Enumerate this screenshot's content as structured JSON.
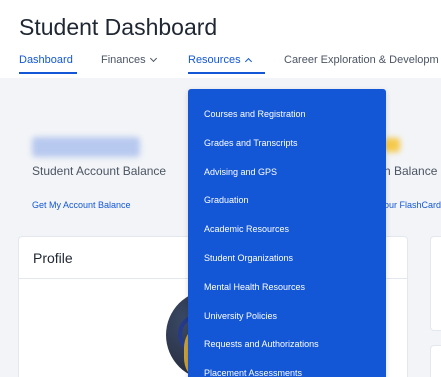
{
  "page": {
    "title": "Student Dashboard"
  },
  "nav": {
    "items": [
      {
        "label": "Dashboard"
      },
      {
        "label": "Finances"
      },
      {
        "label": "Resources"
      },
      {
        "label": "Career Exploration & Developm"
      }
    ]
  },
  "resources_menu": {
    "items": [
      "Courses and Registration",
      "Grades and Transcripts",
      "Advising and GPS",
      "Graduation",
      "Academic Resources",
      "Student Organizations",
      "Mental Health Resources",
      "University Policies",
      "Requests and Authorizations",
      "Placement Assessments"
    ]
  },
  "account_balance": {
    "label": "Student Account Balance",
    "link": "Get My Account Balance"
  },
  "right_card": {
    "label": "h Balance",
    "link": "our FlashCard"
  },
  "profile": {
    "title": "Profile"
  },
  "colors": {
    "accent": "#1357d6",
    "page_bg": "#f2f4f7",
    "card_bg": "#ffffff"
  }
}
